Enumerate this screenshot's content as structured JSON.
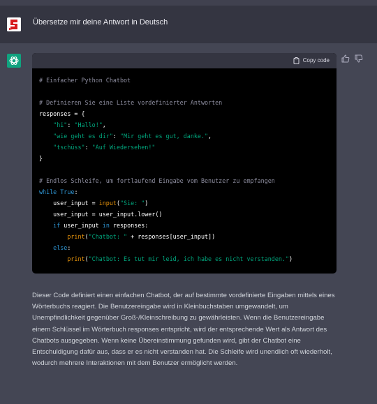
{
  "user_message": "Übersetze mir deine Antwort in Deutsch",
  "code_header": {
    "copy_label": "Copy code"
  },
  "code_lines": [
    [
      {
        "t": "c",
        "v": "# Einfacher Python Chatbot"
      }
    ],
    [],
    [
      {
        "t": "c",
        "v": "# Definieren Sie eine Liste vordefinierter Antworten"
      }
    ],
    [
      {
        "t": "w",
        "v": "responses = {"
      }
    ],
    [
      {
        "t": "w",
        "v": "    "
      },
      {
        "t": "s",
        "v": "\"hi\""
      },
      {
        "t": "w",
        "v": ": "
      },
      {
        "t": "s",
        "v": "\"Hallo!\""
      },
      {
        "t": "w",
        "v": ","
      }
    ],
    [
      {
        "t": "w",
        "v": "    "
      },
      {
        "t": "s",
        "v": "\"wie geht es dir\""
      },
      {
        "t": "w",
        "v": ": "
      },
      {
        "t": "s",
        "v": "\"Mir geht es gut, danke.\""
      },
      {
        "t": "w",
        "v": ","
      }
    ],
    [
      {
        "t": "w",
        "v": "    "
      },
      {
        "t": "s",
        "v": "\"tschüss\""
      },
      {
        "t": "w",
        "v": ": "
      },
      {
        "t": "s",
        "v": "\"Auf Wiedersehen!\""
      }
    ],
    [
      {
        "t": "w",
        "v": "}"
      }
    ],
    [],
    [
      {
        "t": "c",
        "v": "# Endlos Schleife, um fortlaufend Eingabe vom Benutzer zu empfangen"
      }
    ],
    [
      {
        "t": "k",
        "v": "while"
      },
      {
        "t": "w",
        "v": " "
      },
      {
        "t": "k",
        "v": "True"
      },
      {
        "t": "w",
        "v": ":"
      }
    ],
    [
      {
        "t": "w",
        "v": "    user_input = "
      },
      {
        "t": "f",
        "v": "input"
      },
      {
        "t": "w",
        "v": "("
      },
      {
        "t": "s",
        "v": "\"Sie: \""
      },
      {
        "t": "w",
        "v": ")"
      }
    ],
    [
      {
        "t": "w",
        "v": "    user_input = user_input.lower()"
      }
    ],
    [
      {
        "t": "w",
        "v": "    "
      },
      {
        "t": "k",
        "v": "if"
      },
      {
        "t": "w",
        "v": " user_input "
      },
      {
        "t": "k",
        "v": "in"
      },
      {
        "t": "w",
        "v": " responses:"
      }
    ],
    [
      {
        "t": "w",
        "v": "        "
      },
      {
        "t": "f",
        "v": "print"
      },
      {
        "t": "w",
        "v": "("
      },
      {
        "t": "s",
        "v": "\"Chatbot: \""
      },
      {
        "t": "w",
        "v": " + responses[user_input])"
      }
    ],
    [
      {
        "t": "w",
        "v": "    "
      },
      {
        "t": "k",
        "v": "else"
      },
      {
        "t": "w",
        "v": ":"
      }
    ],
    [
      {
        "t": "w",
        "v": "        "
      },
      {
        "t": "f",
        "v": "print"
      },
      {
        "t": "w",
        "v": "("
      },
      {
        "t": "s",
        "v": "\"Chatbot: Es tut mir leid, ich habe es nicht verstanden.\""
      },
      {
        "t": "w",
        "v": ")"
      }
    ]
  ],
  "explanation": "Dieser Code definiert einen einfachen Chatbot, der auf bestimmte vordefinierte Eingaben mittels eines Wörterbuchs reagiert. Die Benutzereingabe wird in Kleinbuchstaben umgewandelt, um Unempfindlichkeit gegenüber Groß-/Kleinschreibung zu gewährleisten. Wenn die Benutzereingabe einem Schlüssel im Wörterbuch responses entspricht, wird der entsprechende Wert als Antwort des Chatbots ausgegeben. Wenn keine Übereinstimmung gefunden wird, gibt der Chatbot eine Entschuldigung dafür aus, dass er es nicht verstanden hat. Die Schleife wird unendlich oft wiederholt, wodurch mehrere Interaktionen mit dem Benutzer ermöglicht werden.",
  "colors": {
    "background": "#343541",
    "assistant_background": "#444654",
    "code_background": "#000000",
    "comment": "#8e8ea0",
    "string": "#00a67d",
    "keyword": "#2e95d3",
    "builtin": "#e9950c",
    "gpt_avatar": "#10a37f"
  },
  "icons": {
    "user_avatar": "user-avatar-icon",
    "assistant_avatar": "chatgpt-logo-icon",
    "copy": "clipboard-icon",
    "thumbs_up": "thumbs-up-icon",
    "thumbs_down": "thumbs-down-icon"
  }
}
